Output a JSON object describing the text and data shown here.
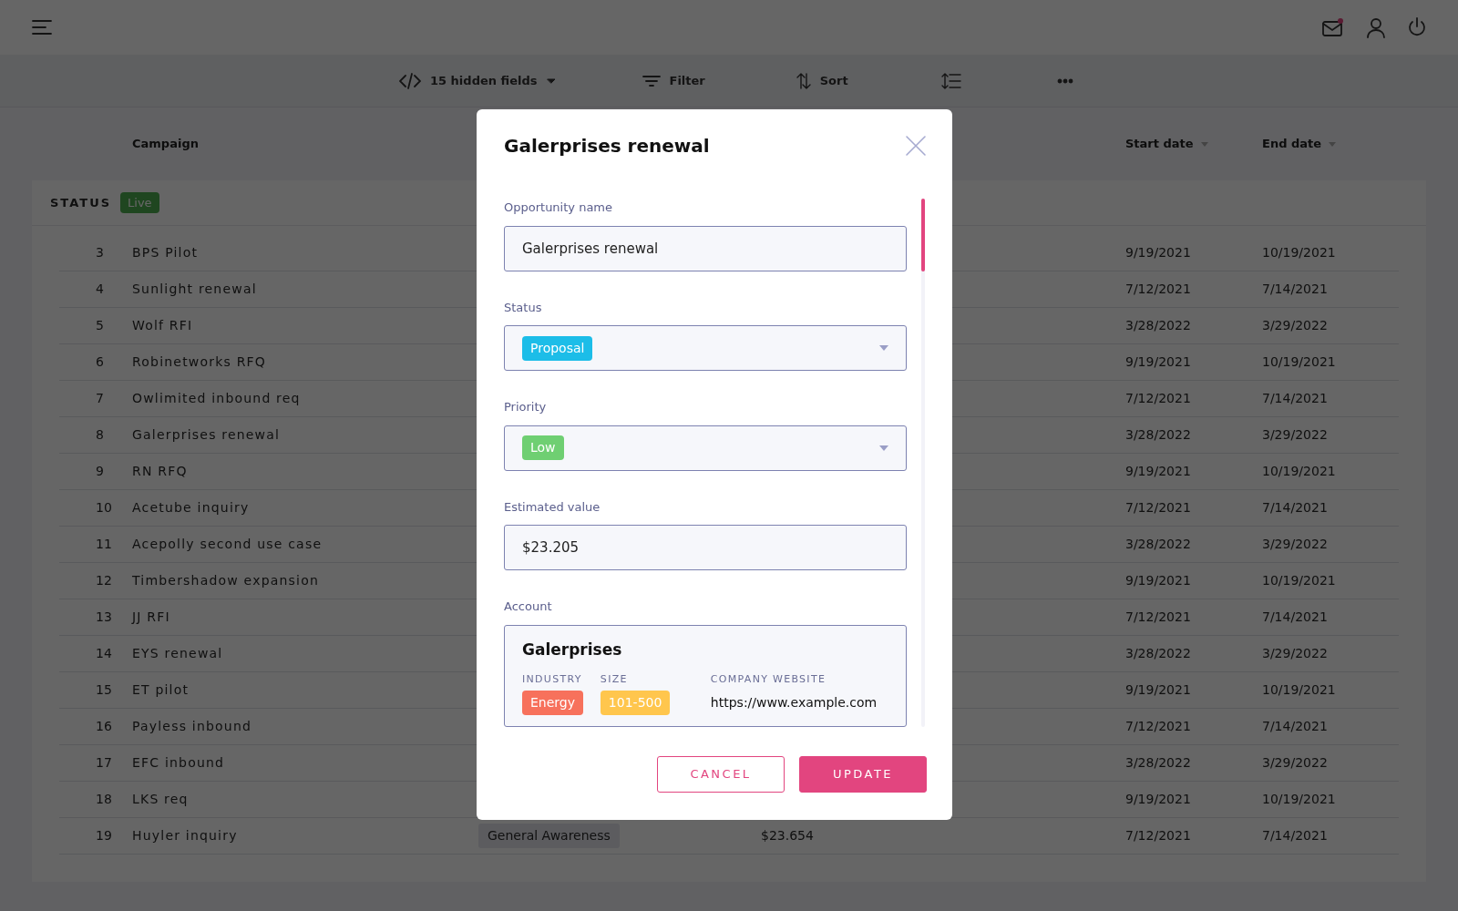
{
  "top_bar": {
    "mail_unread": true
  },
  "toolbar": {
    "hidden_fields": "15 hidden fields",
    "filter": "Filter",
    "sort": "Sort"
  },
  "table": {
    "columns": [
      {
        "label": "Campaign",
        "sortable": false
      },
      {
        "label": "Start date",
        "sortable": true
      },
      {
        "label": "End date",
        "sortable": true
      }
    ],
    "group": {
      "label": "STATUS",
      "value": "Live"
    },
    "rows": [
      {
        "index": "3",
        "campaign": "BPS Pilot",
        "start": "9/19/2021",
        "end": "10/19/2021"
      },
      {
        "index": "4",
        "campaign": "Sunlight renewal",
        "start": "7/12/2021",
        "end": "7/14/2021"
      },
      {
        "index": "5",
        "campaign": "Wolf RFI",
        "start": "3/28/2022",
        "end": "3/29/2022"
      },
      {
        "index": "6",
        "campaign": "Robinetworks RFQ",
        "start": "9/19/2021",
        "end": "10/19/2021"
      },
      {
        "index": "7",
        "campaign": "Owlimited inbound req",
        "start": "7/12/2021",
        "end": "7/14/2021"
      },
      {
        "index": "8",
        "campaign": "Galerprises renewal",
        "start": "3/28/2022",
        "end": "3/29/2022"
      },
      {
        "index": "9",
        "campaign": "RN RFQ",
        "start": "9/19/2021",
        "end": "10/19/2021"
      },
      {
        "index": "10",
        "campaign": "Acetube inquiry",
        "start": "7/12/2021",
        "end": "7/14/2021"
      },
      {
        "index": "11",
        "campaign": "Acepolly second use case",
        "start": "3/28/2022",
        "end": "3/29/2022"
      },
      {
        "index": "12",
        "campaign": "Timbershadow expansion",
        "start": "9/19/2021",
        "end": "10/19/2021"
      },
      {
        "index": "13",
        "campaign": "JJ RFI",
        "start": "7/12/2021",
        "end": "7/14/2021"
      },
      {
        "index": "14",
        "campaign": "EYS renewal",
        "start": "3/28/2022",
        "end": "3/29/2022"
      },
      {
        "index": "15",
        "campaign": "ET pilot",
        "start": "9/19/2021",
        "end": "10/19/2021"
      },
      {
        "index": "16",
        "campaign": "Payless inbound",
        "start": "7/12/2021",
        "end": "7/14/2021"
      },
      {
        "index": "17",
        "campaign": "EFC inbound",
        "start": "3/28/2022",
        "end": "3/29/2022"
      },
      {
        "index": "18",
        "campaign": "LKS req",
        "start": "9/19/2021",
        "end": "10/19/2021"
      },
      {
        "index": "19",
        "campaign": "Huyler inquiry",
        "tag": "General Awareness",
        "value": "$23.654",
        "start": "7/12/2021",
        "end": "7/14/2021"
      }
    ]
  },
  "modal": {
    "title": "Galerprises renewal",
    "fields": [
      {
        "kind": "text",
        "label": "Opportunity name",
        "value": "Galerprises renewal"
      },
      {
        "kind": "select",
        "label": "Status",
        "value": "Proposal",
        "color": "#1cbde8"
      },
      {
        "kind": "select",
        "label": "Priority",
        "value": "Low",
        "color": "#6fcf72"
      },
      {
        "kind": "text",
        "label": "Estimated value",
        "value": "$23.205"
      },
      {
        "kind": "account",
        "label": "Account",
        "name": "Galerprises",
        "attributes": [
          {
            "kind": "tag",
            "label": "INDUSTRY",
            "value": "Energy",
            "color": "#f7715c"
          },
          {
            "kind": "tag",
            "label": "SIZE",
            "value": "101-500",
            "color": "#ffc64d"
          },
          {
            "kind": "text",
            "label": "COMPANY WEBSITE",
            "value": "https://www.example.com"
          }
        ]
      }
    ],
    "buttons": [
      {
        "kind": "outline",
        "label": "CANCEL"
      },
      {
        "kind": "primary",
        "label": "UPDATE"
      }
    ]
  }
}
